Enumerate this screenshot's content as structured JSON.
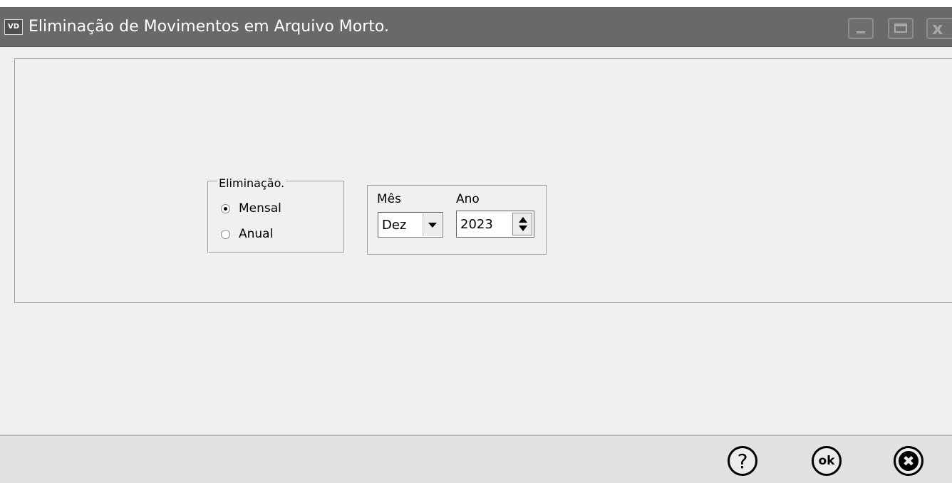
{
  "window": {
    "app_icon": "VD",
    "title": "Eliminação de Movimentos em Arquivo Morto.",
    "controls": [
      "minimize-icon",
      "maximize-icon",
      "close-icon"
    ]
  },
  "elimination_group": {
    "label": "Eliminação.",
    "options": [
      {
        "label": "Mensal",
        "checked": true
      },
      {
        "label": "Anual",
        "checked": false
      }
    ]
  },
  "date": {
    "month_label": "Mês",
    "month_value": "Dez",
    "year_label": "Ano",
    "year_value": "2023"
  },
  "footer": {
    "help_glyph": "?",
    "ok_glyph": "ok",
    "cancel_glyph": "✖"
  }
}
